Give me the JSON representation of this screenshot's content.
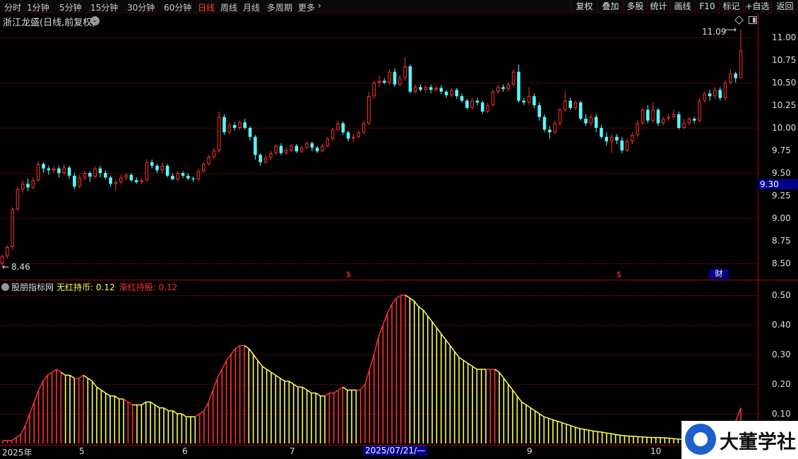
{
  "toolbar": {
    "periods": [
      "分时",
      "1分钟",
      "5分钟",
      "15分钟",
      "30分钟",
      "60分钟",
      "日线",
      "周线",
      "月线",
      "多周期",
      "更多"
    ],
    "active_period": "日线",
    "buttons": [
      "复权",
      "叠加",
      "多股",
      "统计",
      "画线",
      "F10",
      "标记",
      "+自选",
      "返回"
    ]
  },
  "stock": {
    "title": "浙江龙盛(日线,前复权)"
  },
  "price_panel": {
    "high_label": "11.09",
    "low_label": "8.46",
    "current_price": "9.30",
    "events": [
      "$",
      "$",
      "财"
    ]
  },
  "indicator": {
    "name": "股朋指标网",
    "line1": "无红持币: 0.12",
    "line2": "渐红持股: 0.12"
  },
  "date_axis": {
    "labels": [
      "2025年",
      "5",
      "6",
      "7",
      "9",
      "10"
    ],
    "highlight": "2025/07/21/—"
  },
  "watermark": {
    "text": "大董学社"
  },
  "chart_data": [
    {
      "type": "candlestick",
      "title": "浙江龙盛(日线,前复权)",
      "ylim": [
        8.35,
        11.2
      ],
      "yticks": [
        "11.00",
        "10.75",
        "10.50",
        "10.25",
        "10.00",
        "9.75",
        "9.50",
        "9.25",
        "9.00",
        "8.75",
        "8.50"
      ],
      "y_tick_values": [
        11.0,
        10.75,
        10.5,
        10.25,
        10.0,
        9.75,
        9.5,
        9.25,
        9.0,
        8.75,
        8.5
      ],
      "colors": {
        "up": "#ff3030",
        "down": "#55ffff"
      },
      "candles": [
        [
          8.5,
          8.58,
          8.6,
          8.46
        ],
        [
          8.58,
          8.68,
          8.7,
          8.55
        ],
        [
          8.68,
          9.1,
          9.12,
          8.65
        ],
        [
          9.1,
          9.32,
          9.35,
          9.08
        ],
        [
          9.32,
          9.38,
          9.42,
          9.28
        ],
        [
          9.38,
          9.34,
          9.44,
          9.3
        ],
        [
          9.34,
          9.42,
          9.45,
          9.32
        ],
        [
          9.42,
          9.6,
          9.63,
          9.4
        ],
        [
          9.6,
          9.55,
          9.62,
          9.5
        ],
        [
          9.55,
          9.53,
          9.58,
          9.48
        ],
        [
          9.53,
          9.55,
          9.58,
          9.5
        ],
        [
          9.55,
          9.5,
          9.58,
          9.45
        ],
        [
          9.5,
          9.56,
          9.6,
          9.48
        ],
        [
          9.56,
          9.47,
          9.58,
          9.44
        ],
        [
          9.47,
          9.35,
          9.5,
          9.32
        ],
        [
          9.35,
          9.45,
          9.48,
          9.33
        ],
        [
          9.45,
          9.5,
          9.52,
          9.42
        ],
        [
          9.5,
          9.46,
          9.52,
          9.4
        ],
        [
          9.46,
          9.55,
          9.57,
          9.44
        ],
        [
          9.55,
          9.5,
          9.58,
          9.45
        ],
        [
          9.5,
          9.45,
          9.53,
          9.43
        ],
        [
          9.45,
          9.38,
          9.47,
          9.35
        ],
        [
          9.38,
          9.4,
          9.43,
          9.3
        ],
        [
          9.4,
          9.45,
          9.48,
          9.37
        ],
        [
          9.45,
          9.48,
          9.5,
          9.42
        ],
        [
          9.48,
          9.42,
          9.5,
          9.4
        ],
        [
          9.42,
          9.4,
          9.45,
          9.38
        ],
        [
          9.4,
          9.42,
          9.44,
          9.38
        ],
        [
          9.42,
          9.62,
          9.65,
          9.4
        ],
        [
          9.62,
          9.58,
          9.65,
          9.55
        ],
        [
          9.58,
          9.53,
          9.6,
          9.5
        ],
        [
          9.53,
          9.58,
          9.62,
          9.5
        ],
        [
          9.58,
          9.47,
          9.6,
          9.45
        ],
        [
          9.47,
          9.43,
          9.5,
          9.42
        ],
        [
          9.43,
          9.5,
          9.52,
          9.4
        ],
        [
          9.5,
          9.47,
          9.52,
          9.44
        ],
        [
          9.47,
          9.44,
          9.5,
          9.42
        ],
        [
          9.44,
          9.43,
          9.46,
          9.4
        ],
        [
          9.43,
          9.52,
          9.55,
          9.41
        ],
        [
          9.52,
          9.6,
          9.62,
          9.5
        ],
        [
          9.6,
          9.68,
          9.7,
          9.58
        ],
        [
          9.68,
          9.75,
          9.78,
          9.65
        ],
        [
          9.75,
          10.12,
          10.18,
          9.72
        ],
        [
          10.12,
          9.95,
          10.15,
          9.92
        ],
        [
          9.95,
          10.03,
          10.05,
          9.93
        ],
        [
          10.03,
          10.0,
          10.06,
          9.97
        ],
        [
          10.0,
          10.06,
          10.08,
          9.98
        ],
        [
          10.06,
          10.0,
          10.1,
          9.98
        ],
        [
          10.0,
          9.9,
          10.02,
          9.86
        ],
        [
          9.9,
          9.7,
          9.92,
          9.65
        ],
        [
          9.7,
          9.62,
          9.72,
          9.58
        ],
        [
          9.62,
          9.67,
          9.7,
          9.6
        ],
        [
          9.67,
          9.72,
          9.75,
          9.64
        ],
        [
          9.72,
          9.8,
          9.82,
          9.7
        ],
        [
          9.8,
          9.72,
          9.83,
          9.7
        ],
        [
          9.72,
          9.75,
          9.78,
          9.7
        ],
        [
          9.75,
          9.8,
          9.82,
          9.73
        ],
        [
          9.8,
          9.74,
          9.82,
          9.72
        ],
        [
          9.74,
          9.78,
          9.8,
          9.72
        ],
        [
          9.78,
          9.83,
          9.85,
          9.76
        ],
        [
          9.83,
          9.78,
          9.85,
          9.74
        ],
        [
          9.78,
          9.74,
          9.8,
          9.72
        ],
        [
          9.74,
          9.8,
          9.82,
          9.73
        ],
        [
          9.8,
          9.88,
          9.9,
          9.78
        ],
        [
          9.88,
          9.98,
          10.0,
          9.86
        ],
        [
          9.98,
          10.05,
          10.08,
          9.96
        ],
        [
          10.05,
          9.95,
          10.07,
          9.92
        ],
        [
          9.95,
          9.88,
          9.97,
          9.85
        ],
        [
          9.88,
          9.9,
          9.93,
          9.84
        ],
        [
          9.9,
          9.95,
          9.97,
          9.88
        ],
        [
          9.95,
          10.05,
          10.08,
          9.93
        ],
        [
          10.05,
          10.35,
          10.4,
          10.03
        ],
        [
          10.35,
          10.5,
          10.52,
          10.32
        ],
        [
          10.5,
          10.52,
          10.58,
          10.45
        ],
        [
          10.52,
          10.5,
          10.55,
          10.48
        ],
        [
          10.5,
          10.62,
          10.65,
          10.48
        ],
        [
          10.62,
          10.48,
          10.66,
          10.45
        ],
        [
          10.48,
          10.55,
          10.58,
          10.46
        ],
        [
          10.55,
          10.68,
          10.78,
          10.52
        ],
        [
          10.68,
          10.4,
          10.7,
          10.38
        ],
        [
          10.4,
          10.45,
          10.48,
          10.38
        ],
        [
          10.45,
          10.42,
          10.48,
          10.4
        ],
        [
          10.42,
          10.45,
          10.47,
          10.39
        ],
        [
          10.45,
          10.42,
          10.48,
          10.38
        ],
        [
          10.42,
          10.44,
          10.46,
          10.4
        ],
        [
          10.44,
          10.4,
          10.47,
          10.37
        ],
        [
          10.4,
          10.36,
          10.42,
          10.33
        ],
        [
          10.36,
          10.42,
          10.44,
          10.34
        ],
        [
          10.42,
          10.35,
          10.44,
          10.32
        ],
        [
          10.35,
          10.3,
          10.38,
          10.28
        ],
        [
          10.3,
          10.22,
          10.32,
          10.2
        ],
        [
          10.22,
          10.3,
          10.33,
          10.2
        ],
        [
          10.3,
          10.28,
          10.33,
          10.25
        ],
        [
          10.28,
          10.18,
          10.3,
          10.15
        ],
        [
          10.18,
          10.25,
          10.28,
          10.16
        ],
        [
          10.25,
          10.4,
          10.42,
          10.23
        ],
        [
          10.4,
          10.45,
          10.48,
          10.38
        ],
        [
          10.45,
          10.43,
          10.48,
          10.4
        ],
        [
          10.43,
          10.48,
          10.5,
          10.4
        ],
        [
          10.48,
          10.62,
          10.65,
          10.45
        ],
        [
          10.62,
          10.3,
          10.7,
          10.28
        ],
        [
          10.3,
          10.28,
          10.33,
          10.25
        ],
        [
          10.28,
          10.35,
          10.45,
          10.25
        ],
        [
          10.35,
          10.25,
          10.38,
          10.22
        ],
        [
          10.25,
          10.12,
          10.28,
          10.08
        ],
        [
          10.12,
          9.98,
          10.15,
          9.95
        ],
        [
          9.98,
          9.95,
          10.02,
          9.88
        ],
        [
          9.95,
          10.05,
          10.08,
          9.93
        ],
        [
          10.05,
          10.2,
          10.22,
          10.02
        ],
        [
          10.2,
          10.3,
          10.4,
          10.18
        ],
        [
          10.3,
          10.22,
          10.33,
          10.2
        ],
        [
          10.22,
          10.28,
          10.3,
          10.2
        ],
        [
          10.28,
          10.1,
          10.3,
          10.08
        ],
        [
          10.1,
          10.05,
          10.15,
          10.02
        ],
        [
          10.05,
          10.12,
          10.15,
          10.02
        ],
        [
          10.12,
          10.0,
          10.15,
          9.95
        ],
        [
          10.0,
          9.9,
          10.03,
          9.88
        ],
        [
          9.9,
          9.85,
          9.95,
          9.8
        ],
        [
          9.85,
          9.9,
          9.93,
          9.72
        ],
        [
          9.9,
          9.86,
          9.93,
          9.82
        ],
        [
          9.86,
          9.75,
          9.9,
          9.72
        ],
        [
          9.75,
          9.85,
          9.88,
          9.73
        ],
        [
          9.85,
          9.92,
          9.95,
          9.82
        ],
        [
          9.92,
          10.05,
          10.08,
          9.9
        ],
        [
          10.05,
          10.2,
          10.22,
          10.03
        ],
        [
          10.2,
          10.08,
          10.25,
          10.05
        ],
        [
          10.08,
          10.2,
          10.28,
          10.05
        ],
        [
          10.2,
          10.05,
          10.22,
          10.02
        ],
        [
          10.05,
          10.1,
          10.12,
          10.03
        ],
        [
          10.1,
          10.12,
          10.15,
          10.08
        ],
        [
          10.12,
          10.15,
          10.2,
          10.1
        ],
        [
          10.15,
          10.0,
          10.18,
          9.98
        ],
        [
          10.0,
          10.05,
          10.1,
          9.98
        ],
        [
          10.05,
          10.1,
          10.12,
          10.03
        ],
        [
          10.1,
          10.08,
          10.12,
          10.05
        ],
        [
          10.08,
          10.3,
          10.33,
          10.06
        ],
        [
          10.3,
          10.38,
          10.4,
          10.28
        ],
        [
          10.38,
          10.35,
          10.42,
          10.3
        ],
        [
          10.35,
          10.42,
          10.45,
          10.32
        ],
        [
          10.42,
          10.33,
          10.45,
          10.3
        ],
        [
          10.33,
          10.5,
          10.52,
          10.3
        ],
        [
          10.5,
          10.6,
          10.65,
          10.48
        ],
        [
          10.6,
          10.55,
          10.62,
          10.5
        ],
        [
          10.55,
          10.85,
          11.09,
          10.65
        ]
      ]
    },
    {
      "type": "bar",
      "title": "股朋指标网",
      "series": [
        {
          "name": "无红持币",
          "color": "#ffff55"
        },
        {
          "name": "渐红持股",
          "color": "#ff3030"
        }
      ],
      "ylim": [
        0,
        0.52
      ],
      "yticks": [
        "0.50",
        "0.40",
        "0.30",
        "0.20",
        "0.10"
      ],
      "y_tick_values": [
        0.5,
        0.4,
        0.3,
        0.2,
        0.1
      ],
      "values": [
        0.01,
        0.01,
        0.01,
        0.02,
        0.03,
        0.06,
        0.1,
        0.14,
        0.18,
        0.21,
        0.23,
        0.24,
        0.25,
        0.24,
        0.23,
        0.23,
        0.22,
        0.22,
        0.23,
        0.22,
        0.21,
        0.19,
        0.18,
        0.17,
        0.16,
        0.16,
        0.15,
        0.15,
        0.14,
        0.13,
        0.13,
        0.13,
        0.14,
        0.14,
        0.13,
        0.12,
        0.12,
        0.11,
        0.11,
        0.1,
        0.1,
        0.09,
        0.09,
        0.09,
        0.1,
        0.11,
        0.14,
        0.18,
        0.22,
        0.25,
        0.28,
        0.3,
        0.32,
        0.33,
        0.33,
        0.32,
        0.3,
        0.28,
        0.26,
        0.25,
        0.24,
        0.23,
        0.22,
        0.21,
        0.21,
        0.2,
        0.19,
        0.19,
        0.18,
        0.17,
        0.17,
        0.16,
        0.16,
        0.17,
        0.17,
        0.18,
        0.19,
        0.18,
        0.18,
        0.18,
        0.18,
        0.2,
        0.25,
        0.3,
        0.36,
        0.4,
        0.44,
        0.47,
        0.49,
        0.5,
        0.5,
        0.49,
        0.48,
        0.46,
        0.45,
        0.43,
        0.41,
        0.39,
        0.37,
        0.35,
        0.33,
        0.31,
        0.29,
        0.28,
        0.27,
        0.26,
        0.25,
        0.25,
        0.25,
        0.25,
        0.25,
        0.24,
        0.22,
        0.2,
        0.18,
        0.16,
        0.14,
        0.13,
        0.12,
        0.11,
        0.1,
        0.09,
        0.085,
        0.08,
        0.075,
        0.07,
        0.065,
        0.06,
        0.055,
        0.05,
        0.048,
        0.045,
        0.042,
        0.04,
        0.038,
        0.035,
        0.033,
        0.03,
        0.028,
        0.026,
        0.025,
        0.024,
        0.023,
        0.022,
        0.021,
        0.02,
        0.02,
        0.02,
        0.019,
        0.018,
        0.016,
        0.015,
        0.014,
        0.013,
        0.012,
        0.012,
        0.012,
        0.012,
        0.012,
        0.012,
        0.01,
        0.01,
        0.02,
        0.05,
        0.08,
        0.12
      ],
      "red_flags": [
        1,
        1,
        1,
        1,
        1,
        1,
        1,
        1,
        1,
        1,
        1,
        1,
        1,
        1,
        0,
        0,
        0,
        1,
        1,
        0,
        0,
        0,
        0,
        0,
        0,
        0,
        0,
        0,
        1,
        1,
        0,
        0,
        0,
        0,
        0,
        0,
        0,
        0,
        0,
        0,
        0,
        0,
        0,
        0,
        1,
        1,
        1,
        1,
        1,
        1,
        1,
        1,
        1,
        1,
        1,
        0,
        0,
        0,
        0,
        0,
        0,
        0,
        0,
        0,
        0,
        0,
        0,
        0,
        0,
        0,
        0,
        0,
        0,
        1,
        1,
        1,
        1,
        0,
        0,
        0,
        1,
        1,
        1,
        1,
        1,
        1,
        1,
        1,
        1,
        1,
        1,
        0,
        0,
        0,
        0,
        0,
        0,
        0,
        0,
        0,
        0,
        0,
        0,
        0,
        0,
        0,
        0,
        0,
        0,
        1,
        1,
        0,
        0,
        0,
        0,
        0,
        0,
        0,
        0,
        0,
        0,
        0,
        0,
        0,
        0,
        0,
        0,
        0,
        0,
        0,
        0,
        0,
        0,
        0,
        0,
        0,
        0,
        0,
        0,
        0,
        0,
        0,
        0,
        0,
        0,
        0,
        0,
        0,
        0,
        0,
        0,
        0,
        0,
        0,
        0,
        0,
        0,
        0,
        0,
        0,
        0,
        0,
        1,
        1,
        1,
        1
      ]
    }
  ]
}
